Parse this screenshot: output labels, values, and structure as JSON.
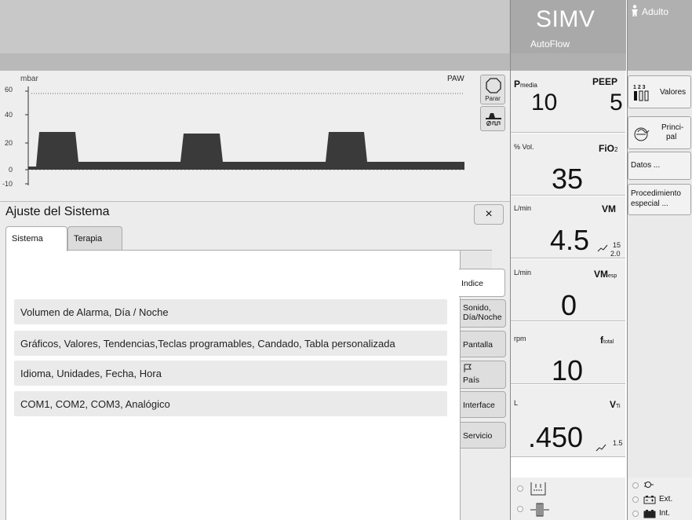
{
  "header": {
    "mode": "SIMV",
    "mode_sub": "AutoFlow",
    "patient_type": "Adulto"
  },
  "waveform": {
    "unit": "mbar",
    "label": "PAW",
    "y_ticks": [
      "60",
      "40",
      "20",
      "0",
      "-10"
    ],
    "stop_label": "Parar"
  },
  "dialog": {
    "title": "Ajuste del Sistema",
    "close": "×",
    "tabs": [
      "Sistema",
      "Terapia"
    ],
    "rows": [
      "Volumen de Alarma, Día / Noche",
      "Gráficos, Valores, Tendencias,Teclas programables, Candado, Tabla personalizada",
      "Idioma, Unidades, Fecha, Hora",
      "COM1, COM2, COM3, Analógico"
    ],
    "side_tabs": {
      "indice": "Indice",
      "sonido_1": "Sonido,",
      "sonido_2": "Día/Noche",
      "pantalla": "Pantalla",
      "pais": "País",
      "interface": "Interface",
      "servicio": "Servicio"
    }
  },
  "params": {
    "pmedia": {
      "name": "P",
      "sub": "media",
      "value": "10"
    },
    "peep": {
      "name": "PEEP",
      "value": "5"
    },
    "fio2": {
      "unit": "% Vol.",
      "name": "FiO",
      "sub": "2",
      "value": "35"
    },
    "vm": {
      "unit": "L/min",
      "name": "VM",
      "value": "4.5",
      "upper": "15",
      "lower": "2.0"
    },
    "vmesp": {
      "unit": "L/min",
      "name": "VM",
      "sub": "esp",
      "value": "0"
    },
    "ftotal": {
      "unit": "rpm",
      "name": "f",
      "sub": "total",
      "value": "10"
    },
    "vti": {
      "unit": "L",
      "name": "V",
      "sub": "Ti",
      "value": ".450",
      "upper": "1.5"
    }
  },
  "menu": {
    "valores": "Valores",
    "valores_digits": "1 2 3",
    "principal_1": "Princi-",
    "principal_2": "pal",
    "datos": "Datos ...",
    "procedimiento_1": "Procedimiento",
    "procedimiento_2": "especial ..."
  },
  "status": {
    "ext": "Ext.",
    "int": "Int."
  }
}
